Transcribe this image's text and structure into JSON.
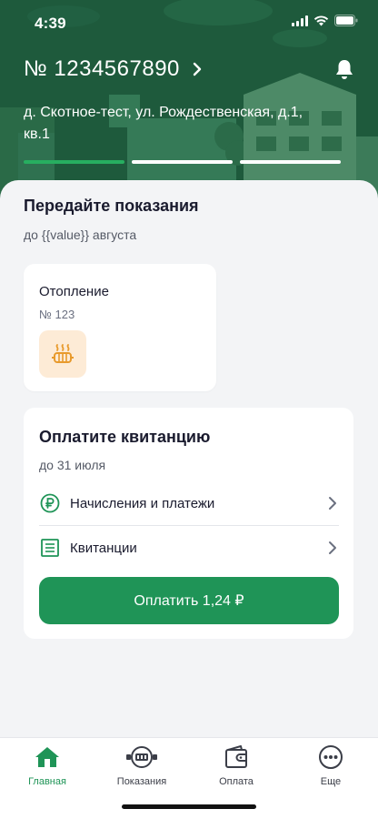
{
  "status_bar": {
    "time": "4:39"
  },
  "header": {
    "account_number": "№ 1234567890",
    "address": "д. Скотное-тест, ул. Рождественская, д.1, кв.1",
    "progress_segments": 3,
    "active_segment": 1
  },
  "readings": {
    "title": "Передайте показания",
    "subtitle": "до {{value}} августа",
    "meter": {
      "name": "Отопление",
      "number": "№ 123",
      "icon": "heater-icon"
    }
  },
  "payment": {
    "title": "Оплатите квитанцию",
    "subtitle": "до 31 июля",
    "rows": [
      {
        "label": "Начисления и платежи",
        "icon": "ruble-circle-icon"
      },
      {
        "label": "Квитанции",
        "icon": "receipt-icon"
      }
    ],
    "button": "Оплатить 1,24 ₽"
  },
  "tabs": [
    {
      "label": "Главная",
      "icon": "home-icon",
      "active": true
    },
    {
      "label": "Показания",
      "icon": "meter-icon",
      "active": false
    },
    {
      "label": "Оплата",
      "icon": "wallet-icon",
      "active": false
    },
    {
      "label": "Еще",
      "icon": "more-icon",
      "active": false
    }
  ],
  "colors": {
    "accent": "#1f9457",
    "header_bg": "#1e5a3c",
    "progress_active": "#27ae60",
    "meter_icon_bg": "#fdebd6",
    "meter_icon": "#e89a2c"
  }
}
